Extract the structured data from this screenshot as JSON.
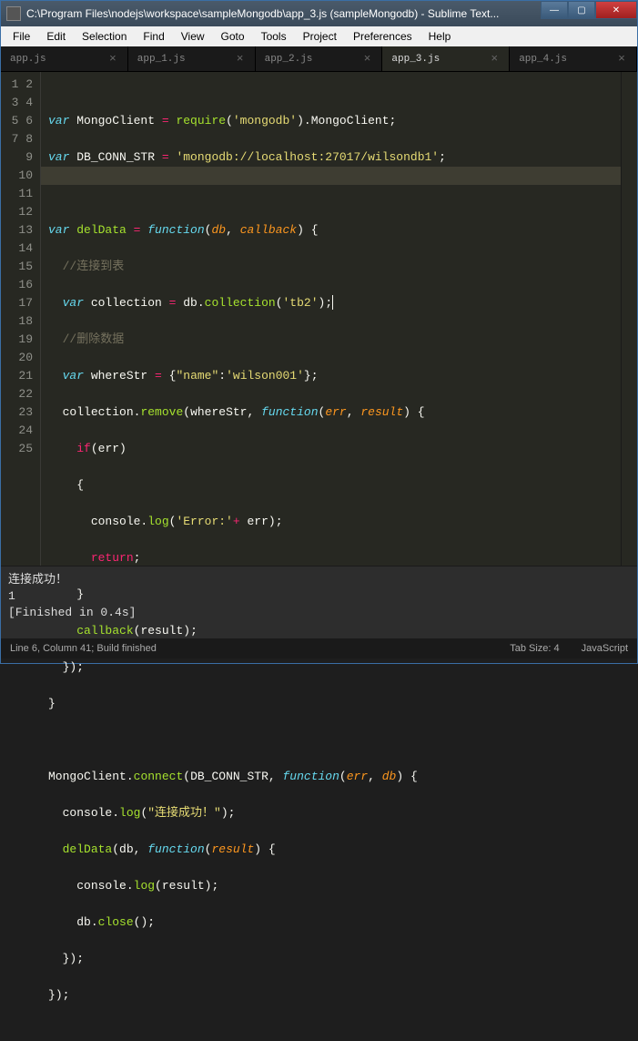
{
  "titlebar": {
    "text": "C:\\Program Files\\nodejs\\workspace\\sampleMongodb\\app_3.js (sampleMongodb) - Sublime Text..."
  },
  "window_controls": {
    "min": "—",
    "max": "▢",
    "close": "✕"
  },
  "menu": {
    "items": [
      "File",
      "Edit",
      "Selection",
      "Find",
      "View",
      "Goto",
      "Tools",
      "Project",
      "Preferences",
      "Help"
    ]
  },
  "tabs": {
    "items": [
      {
        "label": "app.js",
        "active": false,
        "dirty": false
      },
      {
        "label": "app_1.js",
        "active": false,
        "dirty": false
      },
      {
        "label": "app_2.js",
        "active": false,
        "dirty": false
      },
      {
        "label": "app_3.js",
        "active": true,
        "dirty": false
      },
      {
        "label": "app_4.js",
        "active": false,
        "dirty": false
      }
    ]
  },
  "editor": {
    "line_count": 25,
    "current_line": 6,
    "tokens": {
      "var": "var",
      "MongoClient": "MongoClient",
      "eq": " = ",
      "require": "require",
      "lp": "(",
      "rp": ")",
      "s_mongodb": "'mongodb'",
      "dot": ".",
      "semi": ";",
      "DB_CONN_STR": "DB_CONN_STR",
      "s_conn": "'mongodb://localhost:27017/wilsondb1'",
      "delData": "delData",
      "function": "function",
      "db": "db",
      "callback": "callback",
      "lb": "{",
      "rb": "}",
      "comma": ", ",
      "cm1": "//连接到表",
      "collection": "collection",
      "s_tb2": "'tb2'",
      "cm2": "//删除数据",
      "whereStr": "whereStr",
      "obj_open": "{",
      "s_name": "\"name\"",
      "colon": ":",
      "s_wilson": "'wilson001'",
      "obj_close": "}",
      "remove": "remove",
      "err": "err",
      "result": "result",
      "if": "if",
      "console": "console",
      "log": "log",
      "s_error": "'Error:'",
      "plus": "+ ",
      "return": "return",
      "connect": "connect",
      "s_succ": "\"连接成功！\"",
      "close": "close"
    }
  },
  "console": {
    "line1": "连接成功！",
    "line2": "1",
    "line3": "[Finished in 0.4s]"
  },
  "status": {
    "left": "Line 6, Column 41; Build finished",
    "tabsize": "Tab Size: 4",
    "lang": "JavaScript"
  }
}
